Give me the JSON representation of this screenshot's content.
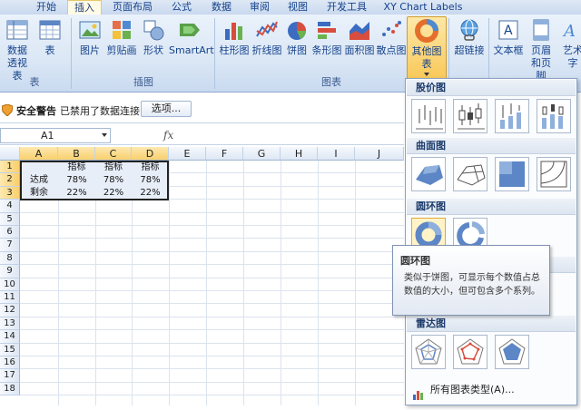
{
  "tabs": [
    "开始",
    "插入",
    "页面布局",
    "公式",
    "数据",
    "审阅",
    "视图",
    "开发工具",
    "XY Chart Labels"
  ],
  "active_tab": "插入",
  "ribbon": {
    "pivot": "数据透视表",
    "table": "表",
    "picture": "图片",
    "clipart": "剪贴画",
    "shapes": "形状",
    "smartart": "SmartArt",
    "column": "柱形图",
    "line": "折线图",
    "pie": "饼图",
    "bar": "条形图",
    "area": "面积图",
    "scatter": "散点图",
    "other": "其他图表",
    "hyperlink": "超链接",
    "textbox": "文本框",
    "header_footer": "页眉和页脚",
    "wordart": "艺术字",
    "group_tables": "表",
    "group_illustrations": "插图",
    "group_charts": "图表"
  },
  "security": {
    "title": "安全警告",
    "message": "已禁用了数据连接",
    "options": "选项..."
  },
  "namebox": "A1",
  "fx": "fx",
  "columns": [
    "A",
    "B",
    "C",
    "D",
    "E",
    "F",
    "G",
    "H",
    "I",
    "J"
  ],
  "rows": [
    "1",
    "2",
    "3",
    "4",
    "5",
    "6",
    "7",
    "8",
    "9",
    "10",
    "11",
    "12",
    "13",
    "14",
    "15",
    "16",
    "17",
    "18"
  ],
  "cells": {
    "b1": "指标",
    "c1": "指标",
    "d1": "指标",
    "a2": "达成",
    "b2": "78%",
    "c2": "78%",
    "d2": "78%",
    "a3": "剩余",
    "b3": "22%",
    "c3": "22%",
    "d3": "22%"
  },
  "dropdown": {
    "stock": "股价图",
    "surface": "曲面图",
    "doughnut": "圆环图",
    "bubble": "气",
    "radar": "雷达图",
    "all_charts": "所有图表类型(A)..."
  },
  "tooltip": {
    "title": "圆环图",
    "desc": "类似于饼图，可显示每个数值占总数值的大小，但可包含多个系列。"
  }
}
